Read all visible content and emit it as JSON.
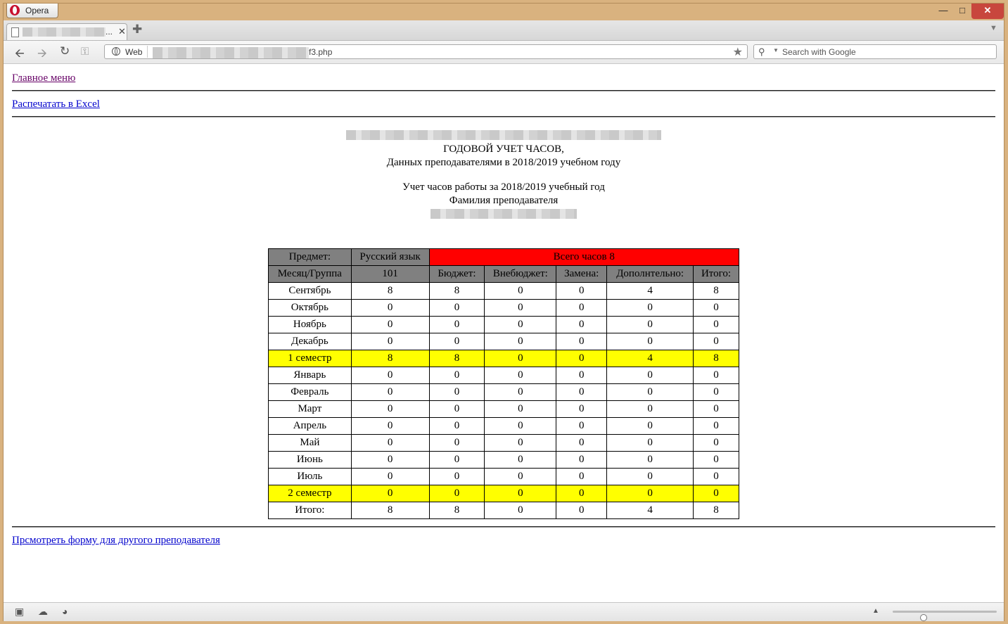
{
  "browser": {
    "app_name": "Opera",
    "tab_title_suffix": "...",
    "web_badge": "Web",
    "url_visible": "f3.php",
    "search_placeholder": "Search with Google",
    "zoom_fraction": 0.3
  },
  "page": {
    "main_menu_link": "Главное меню",
    "excel_link": "Распечатать в Excel",
    "heading1": "ГОДОВОЙ УЧЕТ ЧАСОВ,",
    "heading2": "Данных преподавателями в 2018/2019 учебном году",
    "heading3": "Учет часов работы за 2018/2019 учебный год",
    "heading4": "Фамилия преподавателя",
    "other_teacher_link": "Прсмотреть форму для другого преподавателя"
  },
  "table": {
    "subject_label": "Предмет:",
    "subject_value": "Русский язык",
    "total_hours": "Всего часов 8",
    "month_group_label": "Месяц/Группа",
    "group_value": "101",
    "col_budget": "Бюджет:",
    "col_offbudget": "Внебюджет:",
    "col_replacement": "Замена:",
    "col_additional": "Дополнтельно:",
    "col_total": "Итого:",
    "rows": [
      {
        "name": "Сентябрь",
        "g": "8",
        "b": "8",
        "o": "0",
        "r": "0",
        "a": "4",
        "t": "8",
        "highlight": false
      },
      {
        "name": "Октябрь",
        "g": "0",
        "b": "0",
        "o": "0",
        "r": "0",
        "a": "0",
        "t": "0",
        "highlight": false
      },
      {
        "name": "Ноябрь",
        "g": "0",
        "b": "0",
        "o": "0",
        "r": "0",
        "a": "0",
        "t": "0",
        "highlight": false
      },
      {
        "name": "Декабрь",
        "g": "0",
        "b": "0",
        "o": "0",
        "r": "0",
        "a": "0",
        "t": "0",
        "highlight": false
      },
      {
        "name": "1 семестр",
        "g": "8",
        "b": "8",
        "o": "0",
        "r": "0",
        "a": "4",
        "t": "8",
        "highlight": true
      },
      {
        "name": "Январь",
        "g": "0",
        "b": "0",
        "o": "0",
        "r": "0",
        "a": "0",
        "t": "0",
        "highlight": false
      },
      {
        "name": "Февраль",
        "g": "0",
        "b": "0",
        "o": "0",
        "r": "0",
        "a": "0",
        "t": "0",
        "highlight": false
      },
      {
        "name": "Март",
        "g": "0",
        "b": "0",
        "o": "0",
        "r": "0",
        "a": "0",
        "t": "0",
        "highlight": false
      },
      {
        "name": "Апрель",
        "g": "0",
        "b": "0",
        "o": "0",
        "r": "0",
        "a": "0",
        "t": "0",
        "highlight": false
      },
      {
        "name": "Май",
        "g": "0",
        "b": "0",
        "o": "0",
        "r": "0",
        "a": "0",
        "t": "0",
        "highlight": false
      },
      {
        "name": "Июнь",
        "g": "0",
        "b": "0",
        "o": "0",
        "r": "0",
        "a": "0",
        "t": "0",
        "highlight": false
      },
      {
        "name": "Июль",
        "g": "0",
        "b": "0",
        "o": "0",
        "r": "0",
        "a": "0",
        "t": "0",
        "highlight": false
      },
      {
        "name": "2 семестр",
        "g": "0",
        "b": "0",
        "o": "0",
        "r": "0",
        "a": "0",
        "t": "0",
        "highlight": true
      },
      {
        "name": "Итого:",
        "g": "8",
        "b": "8",
        "o": "0",
        "r": "0",
        "a": "4",
        "t": "8",
        "highlight": false
      }
    ]
  },
  "colors": {
    "header_gray": "#808080",
    "header_red": "#ff0000",
    "semester_yellow": "#ffff00",
    "link_blue": "#0000cc",
    "link_visited": "#660066"
  }
}
